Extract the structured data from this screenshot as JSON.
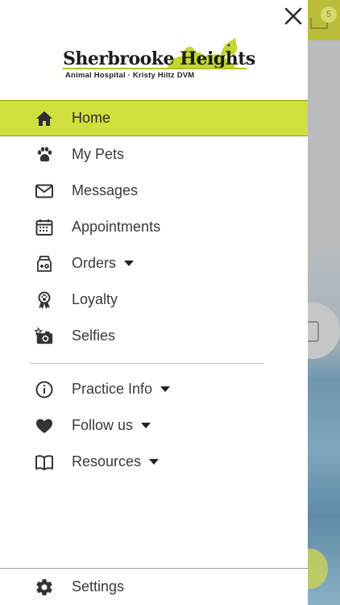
{
  "background": {
    "notification_count": "5"
  },
  "drawer": {
    "logo": {
      "name": "Sherbrooke Heights",
      "subtitle": "Animal Hospital · Kristy Hiltz DVM"
    },
    "primary_items": [
      {
        "label": "Home",
        "icon": "home-icon",
        "active": true
      },
      {
        "label": "My Pets",
        "icon": "paw-icon"
      },
      {
        "label": "Messages",
        "icon": "envelope-icon"
      },
      {
        "label": "Appointments",
        "icon": "calendar-icon"
      },
      {
        "label": "Orders",
        "icon": "food-bag-icon",
        "dropdown": true
      },
      {
        "label": "Loyalty",
        "icon": "paw-ribbon-icon"
      },
      {
        "label": "Selfies",
        "icon": "camera-star-icon"
      }
    ],
    "secondary_items": [
      {
        "label": "Practice Info",
        "icon": "info-icon",
        "dropdown": true
      },
      {
        "label": "Follow us",
        "icon": "heart-icon",
        "dropdown": true
      },
      {
        "label": "Resources",
        "icon": "book-icon",
        "dropdown": true
      }
    ],
    "settings": {
      "label": "Settings",
      "icon": "gear-icon"
    }
  },
  "colors": {
    "accent": "#cfe03d",
    "accent_border": "#8b9a0e",
    "icon": "#333333",
    "text": "#3a3a3a"
  }
}
